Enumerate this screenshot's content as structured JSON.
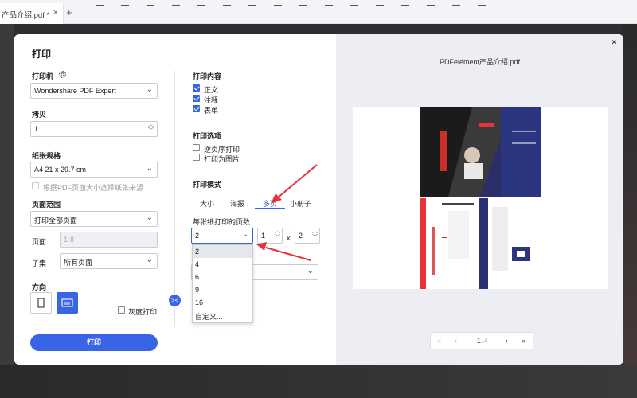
{
  "app": {
    "tab_title": "产品介绍.pdf *",
    "tab_close": "×",
    "tab_add": "+"
  },
  "dialog": {
    "title": "打印",
    "close": "×",
    "printer": {
      "label": "打印机",
      "value": "Wondershare PDF Expert"
    },
    "copies": {
      "label": "拷贝",
      "value": "1"
    },
    "paper_size": {
      "label": "纸张规格",
      "value": "A4 21 x 29.7 cm",
      "auto_source_label": "根据PDF页面大小选择纸张来源"
    },
    "page_range": {
      "label": "页面范围",
      "value": "打印全部页面",
      "pages_label": "页面",
      "pages_placeholder": "1-8",
      "subset_label": "子集",
      "subset_value": "所有页面"
    },
    "orientation": {
      "label": "方向",
      "grayscale_label": "灰度打印"
    },
    "print_button": "打印",
    "collapse_glyph": "><",
    "print_content": {
      "label": "打印内容",
      "items": [
        {
          "label": "正文",
          "checked": true
        },
        {
          "label": "注释",
          "checked": true
        },
        {
          "label": "表单",
          "checked": true
        }
      ]
    },
    "print_options": {
      "label": "打印选项",
      "items": [
        {
          "label": "逆页序打印",
          "checked": false
        },
        {
          "label": "打印为图片",
          "checked": false
        }
      ]
    },
    "print_mode": {
      "label": "打印模式",
      "tabs": [
        "大小",
        "海报",
        "多页",
        "小册子"
      ],
      "active_tab": "多页",
      "pages_per_sheet_label": "每张纸打印的页数",
      "pages_per_sheet_value": "2",
      "cols_value": "1",
      "times": "x",
      "rows_value": "2",
      "dropdown_options": [
        "2",
        "4",
        "6",
        "9",
        "16",
        "自定义..."
      ],
      "highlighted_option": "2"
    }
  },
  "preview": {
    "file_name": "PDFelement产品介绍.pdf",
    "page_current": "1",
    "page_total": "/4",
    "first": "«",
    "prev": "‹",
    "next": "›",
    "last": "»"
  },
  "colors": {
    "accent": "#3a64e6",
    "annotation_arrow": "#e5333a"
  }
}
